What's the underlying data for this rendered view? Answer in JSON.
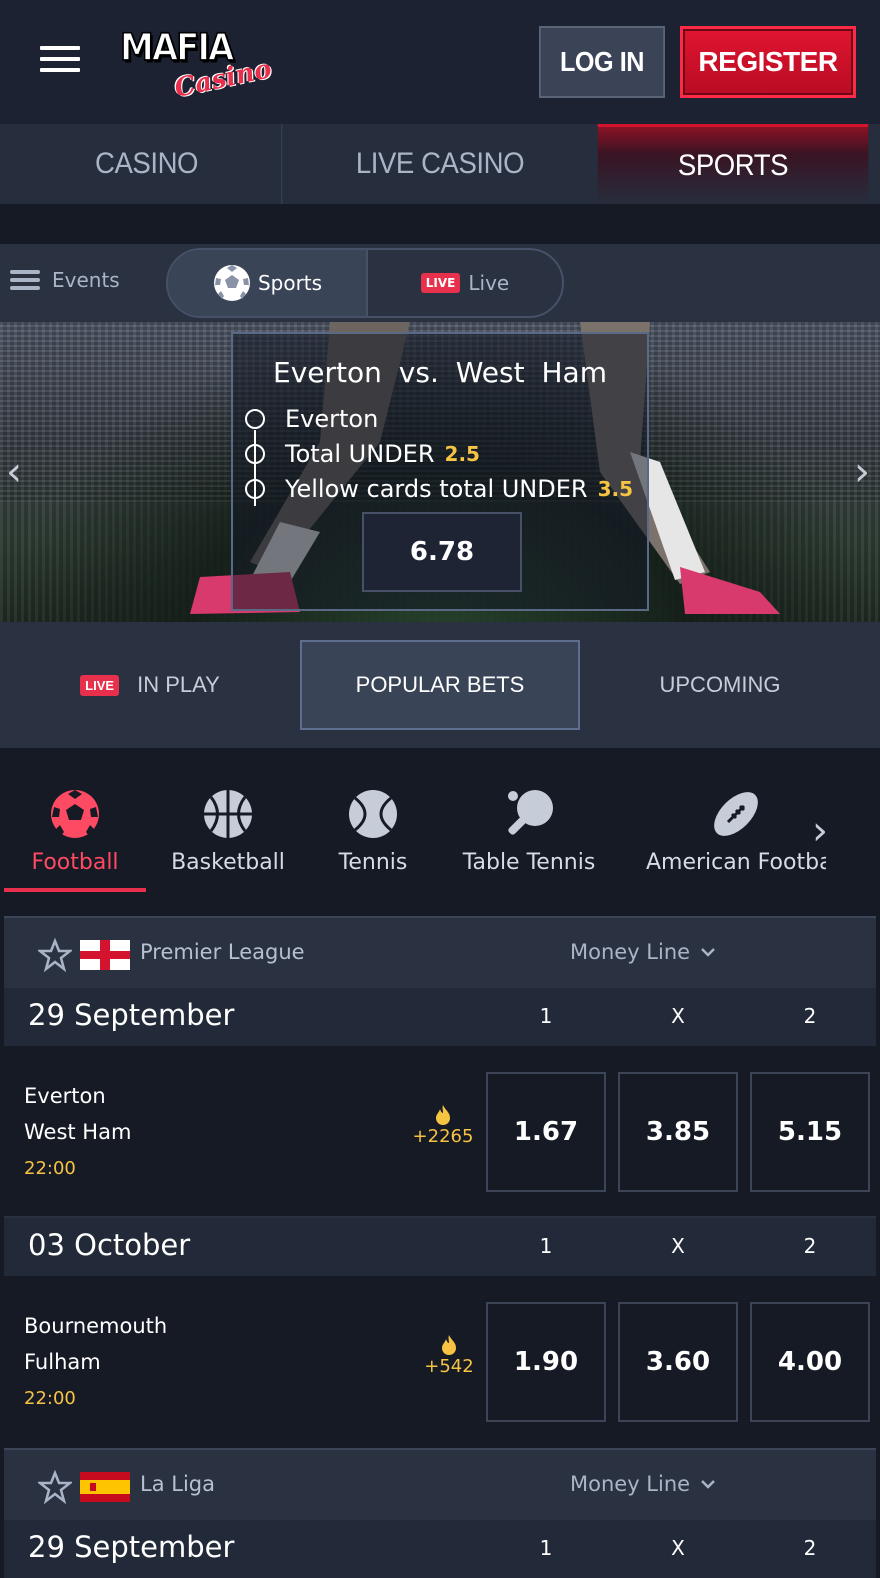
{
  "header": {
    "logo_text": "MAFIA",
    "logo_sub": "Casino",
    "login_label": "LOG IN",
    "register_label": "REGISTER"
  },
  "topnav": [
    "CASINO",
    "LIVE CASINO",
    "SPORTS"
  ],
  "subnav": {
    "events_label": "Events",
    "sports_label": "Sports",
    "live_badge": "LIVE",
    "live_label": "Live"
  },
  "banner": {
    "team1": "Everton",
    "vs": "vs.",
    "team2": "West Ham",
    "selections": [
      {
        "text": "Everton",
        "value": ""
      },
      {
        "text": "Total UNDER",
        "value": "2.5"
      },
      {
        "text": "Yellow cards total UNDER",
        "value": "3.5"
      }
    ],
    "odds": "6.78"
  },
  "betnav": {
    "live_badge": "LIVE",
    "in_play": "IN PLAY",
    "popular": "POPULAR BETS",
    "upcoming": "UPCOMING"
  },
  "sports": [
    "Football",
    "Basketball",
    "Tennis",
    "Table Tennis",
    "American Football"
  ],
  "leagues": [
    {
      "name": "Premier League",
      "market": "Money Line",
      "days": [
        {
          "date": "29 September",
          "cols": [
            "1",
            "X",
            "2"
          ],
          "match": {
            "home": "Everton",
            "away": "West Ham",
            "time": "22:00",
            "count": "+2265",
            "odds": [
              "1.67",
              "3.85",
              "5.15"
            ]
          }
        },
        {
          "date": "03 October",
          "cols": [
            "1",
            "X",
            "2"
          ],
          "match": {
            "home": "Bournemouth",
            "away": "Fulham",
            "time": "22:00",
            "count": "+542",
            "odds": [
              "1.90",
              "3.60",
              "4.00"
            ]
          }
        }
      ]
    },
    {
      "name": "La Liga",
      "market": "Money Line",
      "days": [
        {
          "date": "29 September",
          "cols": [
            "1",
            "X",
            "2"
          ]
        }
      ]
    }
  ],
  "colors": {
    "accent": "#e8304d",
    "gold": "#f6c343",
    "bg": "#151a25",
    "panel": "#2a3242"
  }
}
